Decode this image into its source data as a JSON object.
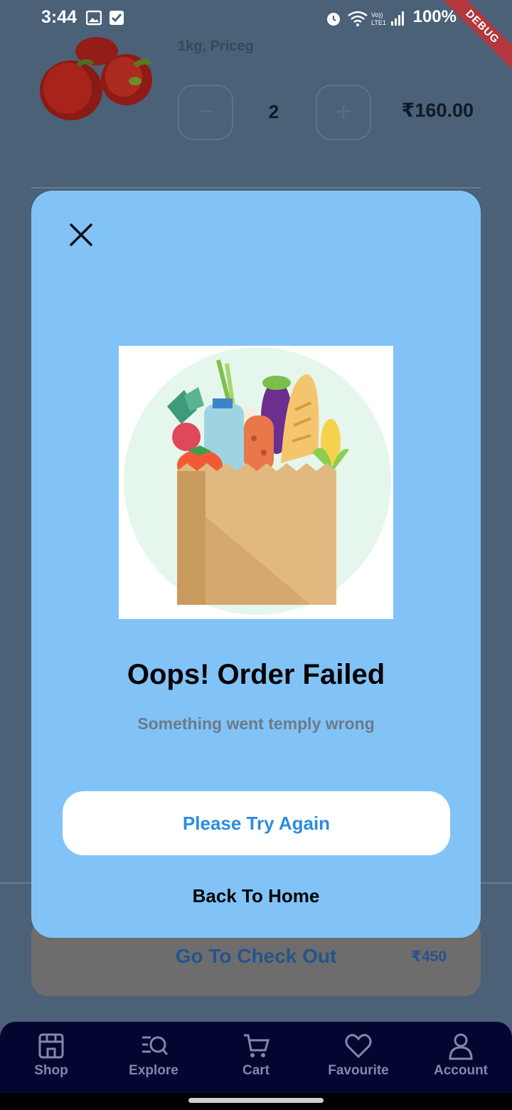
{
  "status_bar": {
    "time": "3:44",
    "battery": "100%",
    "debug_banner": "DEBUG"
  },
  "cart_item": {
    "subtitle": "1kg, Priceg",
    "quantity": "2",
    "decrement_symbol": "−",
    "increment_symbol": "+",
    "price": "₹160.00"
  },
  "checkout": {
    "label": "Go To Check Out",
    "total": "₹450"
  },
  "modal": {
    "title": "Oops! Order Failed",
    "subtitle": "Something went temply wrong",
    "retry_label": "Please Try Again",
    "home_label": "Back To Home"
  },
  "bottom_nav": {
    "items": [
      {
        "label": "Shop",
        "icon": "shop-icon"
      },
      {
        "label": "Explore",
        "icon": "explore-icon"
      },
      {
        "label": "Cart",
        "icon": "cart-icon"
      },
      {
        "label": "Favourite",
        "icon": "heart-icon"
      },
      {
        "label": "Account",
        "icon": "account-icon"
      }
    ]
  },
  "colors": {
    "modal_bg": "#82c3f7",
    "overlay_bg": "#4a6178",
    "nav_bg": "#050531",
    "accent_blue": "#2b8ce0"
  }
}
